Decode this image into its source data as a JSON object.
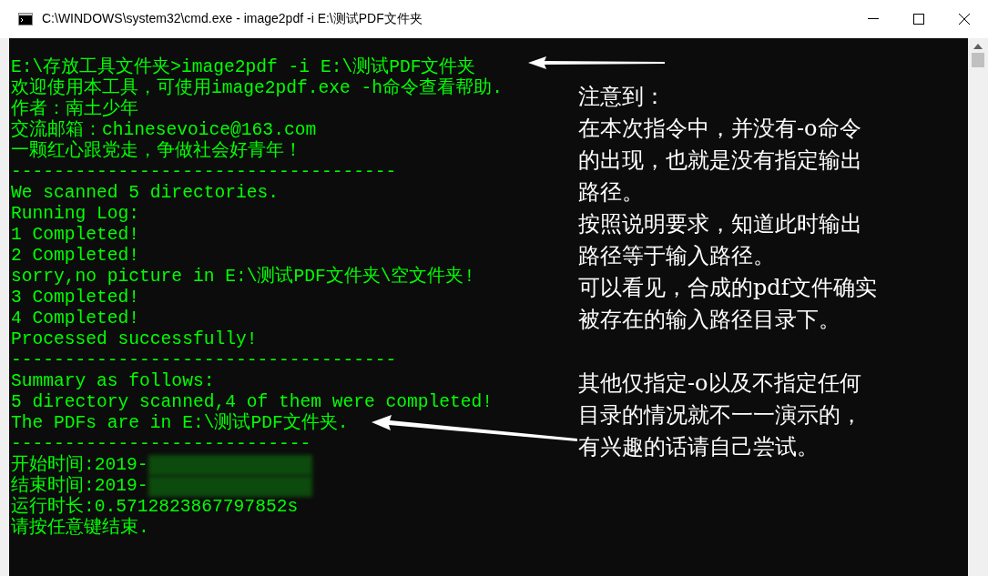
{
  "window": {
    "title": "C:\\WINDOWS\\system32\\cmd.exe - image2pdf  -i E:\\测试PDF文件夹",
    "controls": [
      {
        "kind": "minimize"
      },
      {
        "kind": "maximize"
      },
      {
        "kind": "close"
      }
    ]
  },
  "console": {
    "lines": [
      {
        "kind": "text",
        "text": "E:\\存放工具文件夹>image2pdf -i E:\\测试PDF文件夹"
      },
      {
        "kind": "text",
        "text": "欢迎使用本工具，可使用image2pdf.exe -h命令查看帮助."
      },
      {
        "kind": "text",
        "text": "作者：南土少年"
      },
      {
        "kind": "text",
        "text": "交流邮箱：chinesevoice@163.com"
      },
      {
        "kind": "text",
        "text": "一颗红心跟党走，争做社会好青年！"
      },
      {
        "kind": "rule",
        "text": "------------------------------------"
      },
      {
        "kind": "text",
        "text": "We scanned 5 directories."
      },
      {
        "kind": "text",
        "text": "Running Log:"
      },
      {
        "kind": "text",
        "text": "1 Completed!"
      },
      {
        "kind": "text",
        "text": "2 Completed!"
      },
      {
        "kind": "text",
        "text": "sorry,no picture in E:\\测试PDF文件夹\\空文件夹!"
      },
      {
        "kind": "text",
        "text": "3 Completed!"
      },
      {
        "kind": "text",
        "text": "4 Completed!"
      },
      {
        "kind": "text",
        "text": "Processed successfully!"
      },
      {
        "kind": "rule",
        "text": "------------------------------------"
      },
      {
        "kind": "text",
        "text": "Summary as follows:"
      },
      {
        "kind": "text",
        "text": "5 directory scanned,4 of them were completed!"
      },
      {
        "kind": "text",
        "text": "The PDFs are in E:\\测试PDF文件夹."
      },
      {
        "kind": "rule",
        "text": "----------------------------"
      },
      {
        "kind": "redacted",
        "text": "开始时间:2019-"
      },
      {
        "kind": "redacted",
        "text": "结束时间:2019-"
      },
      {
        "kind": "text",
        "text": "运行时长:0.5712823867797852s"
      },
      {
        "kind": "text",
        "text": "请按任意键结束."
      }
    ]
  },
  "annotation": {
    "paragraphs": [
      [
        "注意到：",
        "在本次指令中，并没有-o命令",
        "的出现，也就是没有指定输出",
        "路径。",
        "按照说明要求，知道此时输出",
        "路径等于输入路径。",
        "可以看见，合成的pdf文件确实",
        "被存在的输入路径目录下。"
      ],
      [
        "其他仅指定-o以及不指定任何",
        "目录的情况就不一一演示的，",
        "有兴趣的话请自己尝试。"
      ]
    ]
  }
}
